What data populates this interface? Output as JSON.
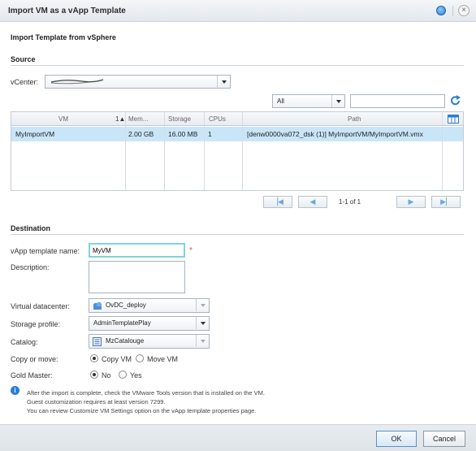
{
  "dialog": {
    "title": "Import VM as a vApp Template",
    "heading": "Import Template from vSphere"
  },
  "source": {
    "section_title": "Source",
    "vcenter_label": "vCenter:",
    "filter_value": "All",
    "search_value": "",
    "table": {
      "columns": [
        "VM",
        "Mem...",
        "Storage",
        "CPUs",
        "Path"
      ],
      "sort_indicator": "1▲",
      "rows": [
        {
          "vm": "MyImportVM",
          "mem": "2.00 GB",
          "storage": "16.00 MB",
          "cpus": "1",
          "path": "[denw0000va072_dsk (1)] MyImportVM/MyImportVM.vmx"
        }
      ]
    },
    "pager": {
      "info": "1-1 of 1"
    }
  },
  "destination": {
    "section_title": "Destination",
    "template_name_label": "vApp template name:",
    "template_name_value": "MyVM",
    "required_marker": "*",
    "description_label": "Description:",
    "description_value": "",
    "vdc_label": "Virtual datacenter:",
    "vdc_value": "OvDC_deploy",
    "storage_profile_label": "Storage profile:",
    "storage_profile_value": "AdminTemplatePlay",
    "catalog_label": "Catalog:",
    "catalog_value": "MzCatalouge",
    "copy_move_label": "Copy or move:",
    "copy_option": "Copy VM",
    "move_option": "Move VM",
    "gold_master_label": "Gold Master:",
    "gold_no": "No",
    "gold_yes": "Yes"
  },
  "notes": [
    "After the import is complete, check the VMware Tools version that is installed on the VM.",
    "Guest customization requires at least version 7299.",
    "You can review Customize VM Settings option on the vApp template properties page."
  ],
  "footer": {
    "ok_label": "OK",
    "cancel_label": "Cancel"
  },
  "colors": {
    "accent": "#2a7fd4",
    "selection": "#c9e6f8",
    "required": "#d9534f"
  }
}
